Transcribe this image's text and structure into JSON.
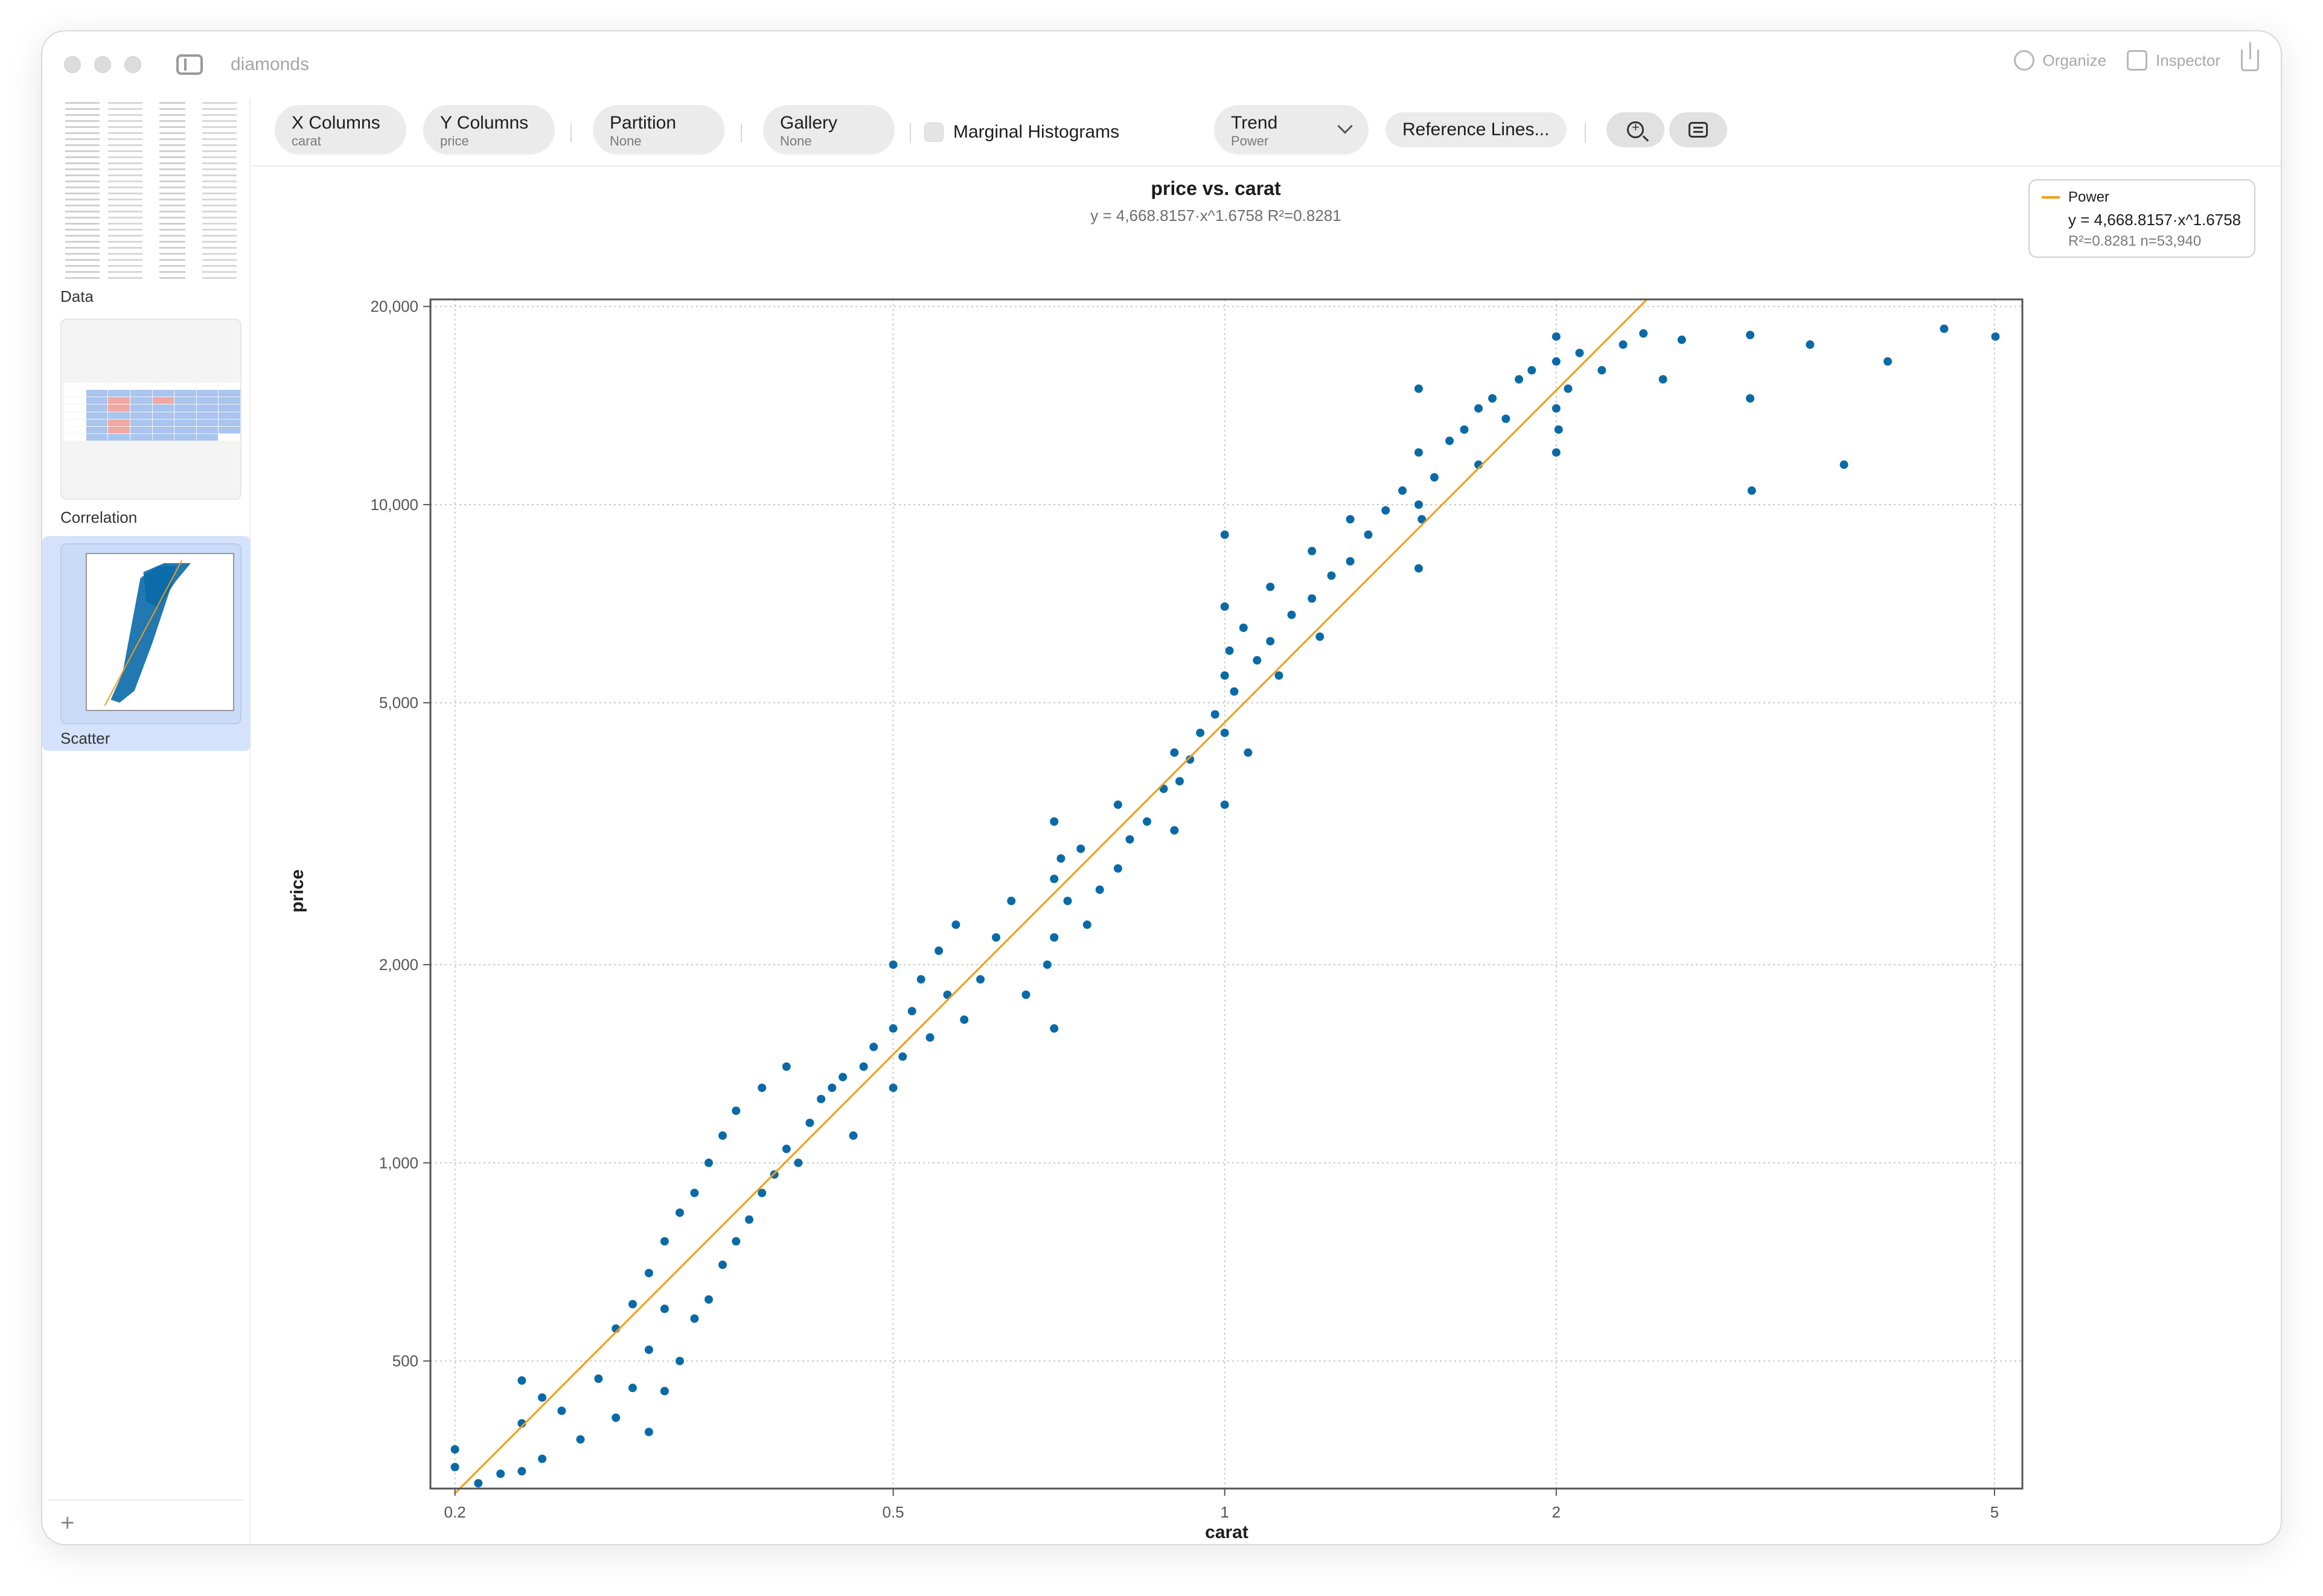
{
  "window": {
    "title": "diamonds"
  },
  "titlebar": {
    "organize_label": "Organize",
    "inspector_label": "Inspector"
  },
  "sidebar": {
    "items": [
      {
        "label": "Data"
      },
      {
        "label": "Correlation"
      },
      {
        "label": "Scatter",
        "selected": true
      }
    ],
    "add_label": "+"
  },
  "toolbar": {
    "x_columns": {
      "title": "X Columns",
      "value": "carat"
    },
    "y_columns": {
      "title": "Y Columns",
      "value": "price"
    },
    "partition": {
      "title": "Partition",
      "value": "None"
    },
    "gallery": {
      "title": "Gallery",
      "value": "None"
    },
    "marginal_histograms": {
      "label": "Marginal Histograms",
      "checked": false
    },
    "trend": {
      "title": "Trend",
      "value": "Power"
    },
    "reference_lines": {
      "label": "Reference Lines..."
    }
  },
  "legend": {
    "name": "Power",
    "equation": "y = 4,668.8157·x^1.6758",
    "stats": "R²=0.8281  n=53,940"
  },
  "colors": {
    "points": "#0a6aa8",
    "trend": "#f39c12",
    "selected_bg": "#d4e3fb"
  },
  "chart_data": {
    "type": "scatter",
    "title": "price vs. carat",
    "subtitle": "y = 4,668.8157·x^1.6758    R²=0.8281",
    "xlabel": "carat",
    "ylabel": "price",
    "x_scale": "log",
    "y_scale": "log",
    "xlim": [
      0.19,
      5.3
    ],
    "ylim": [
      320,
      20500
    ],
    "x_ticks": [
      0.2,
      0.5,
      1,
      2,
      5
    ],
    "x_tick_labels": [
      "0.2",
      "0.5",
      "1",
      "2",
      "5"
    ],
    "y_ticks": [
      500,
      1000,
      2000,
      5000,
      10000,
      20000
    ],
    "y_tick_labels": [
      "500",
      "1,000",
      "2,000",
      "5,000",
      "10,000",
      "20,000"
    ],
    "grid": true,
    "trend": {
      "type": "power",
      "a": 4668.8157,
      "b": 1.6758,
      "r2": 0.8281,
      "n": 53940
    },
    "series": [
      {
        "name": "price",
        "points": [
          [
            0.2,
            345
          ],
          [
            0.2,
            367
          ],
          [
            0.21,
            326
          ],
          [
            0.22,
            337
          ],
          [
            0.23,
            340
          ],
          [
            0.23,
            402
          ],
          [
            0.23,
            467
          ],
          [
            0.24,
            355
          ],
          [
            0.24,
            440
          ],
          [
            0.25,
            420
          ],
          [
            0.26,
            380
          ],
          [
            0.27,
            470
          ],
          [
            0.28,
            410
          ],
          [
            0.28,
            560
          ],
          [
            0.29,
            455
          ],
          [
            0.29,
            610
          ],
          [
            0.3,
            390
          ],
          [
            0.3,
            520
          ],
          [
            0.3,
            680
          ],
          [
            0.31,
            450
          ],
          [
            0.31,
            600
          ],
          [
            0.31,
            760
          ],
          [
            0.32,
            500
          ],
          [
            0.32,
            840
          ],
          [
            0.33,
            580
          ],
          [
            0.33,
            900
          ],
          [
            0.34,
            620
          ],
          [
            0.34,
            1000
          ],
          [
            0.35,
            700
          ],
          [
            0.35,
            1100
          ],
          [
            0.36,
            760
          ],
          [
            0.36,
            1200
          ],
          [
            0.37,
            820
          ],
          [
            0.38,
            900
          ],
          [
            0.38,
            1300
          ],
          [
            0.39,
            960
          ],
          [
            0.4,
            1050
          ],
          [
            0.4,
            1400
          ],
          [
            0.41,
            1000
          ],
          [
            0.42,
            1150
          ],
          [
            0.43,
            1250
          ],
          [
            0.44,
            1300
          ],
          [
            0.45,
            1350
          ],
          [
            0.46,
            1100
          ],
          [
            0.47,
            1400
          ],
          [
            0.48,
            1500
          ],
          [
            0.5,
            1300
          ],
          [
            0.5,
            1600
          ],
          [
            0.5,
            2000
          ],
          [
            0.51,
            1450
          ],
          [
            0.52,
            1700
          ],
          [
            0.53,
            1900
          ],
          [
            0.54,
            1550
          ],
          [
            0.55,
            2100
          ],
          [
            0.56,
            1800
          ],
          [
            0.57,
            2300
          ],
          [
            0.58,
            1650
          ],
          [
            0.6,
            1900
          ],
          [
            0.62,
            2200
          ],
          [
            0.64,
            2500
          ],
          [
            0.66,
            1800
          ],
          [
            0.69,
            2000
          ],
          [
            0.7,
            1600
          ],
          [
            0.7,
            2200
          ],
          [
            0.7,
            2700
          ],
          [
            0.7,
            3300
          ],
          [
            0.71,
            2900
          ],
          [
            0.72,
            2500
          ],
          [
            0.74,
            3000
          ],
          [
            0.75,
            2300
          ],
          [
            0.77,
            2600
          ],
          [
            0.8,
            2800
          ],
          [
            0.8,
            3500
          ],
          [
            0.82,
            3100
          ],
          [
            0.85,
            3300
          ],
          [
            0.88,
            3700
          ],
          [
            0.9,
            3200
          ],
          [
            0.9,
            4200
          ],
          [
            0.91,
            3800
          ],
          [
            0.93,
            4100
          ],
          [
            0.95,
            4500
          ],
          [
            0.98,
            4800
          ],
          [
            1.0,
            3500
          ],
          [
            1.0,
            4500
          ],
          [
            1.0,
            5500
          ],
          [
            1.0,
            7000
          ],
          [
            1.0,
            9000
          ],
          [
            1.01,
            6000
          ],
          [
            1.02,
            5200
          ],
          [
            1.04,
            6500
          ],
          [
            1.05,
            4200
          ],
          [
            1.07,
            5800
          ],
          [
            1.1,
            6200
          ],
          [
            1.1,
            7500
          ],
          [
            1.12,
            5500
          ],
          [
            1.15,
            6800
          ],
          [
            1.2,
            7200
          ],
          [
            1.2,
            8500
          ],
          [
            1.22,
            6300
          ],
          [
            1.25,
            7800
          ],
          [
            1.3,
            8200
          ],
          [
            1.3,
            9500
          ],
          [
            1.35,
            9000
          ],
          [
            1.4,
            9800
          ],
          [
            1.45,
            10500
          ],
          [
            1.5,
            8000
          ],
          [
            1.5,
            10000
          ],
          [
            1.5,
            12000
          ],
          [
            1.5,
            15000
          ],
          [
            1.51,
            9500
          ],
          [
            1.55,
            11000
          ],
          [
            1.6,
            12500
          ],
          [
            1.65,
            13000
          ],
          [
            1.7,
            11500
          ],
          [
            1.7,
            14000
          ],
          [
            1.75,
            14500
          ],
          [
            1.8,
            13500
          ],
          [
            1.85,
            15500
          ],
          [
            1.9,
            16000
          ],
          [
            2.0,
            12000
          ],
          [
            2.0,
            14000
          ],
          [
            2.0,
            16500
          ],
          [
            2.0,
            18000
          ],
          [
            2.01,
            13000
          ],
          [
            2.05,
            15000
          ],
          [
            2.1,
            17000
          ],
          [
            2.2,
            16000
          ],
          [
            2.3,
            17500
          ],
          [
            2.4,
            18200
          ],
          [
            2.5,
            15500
          ],
          [
            2.6,
            17800
          ],
          [
            3.0,
            18100
          ],
          [
            3.0,
            14500
          ],
          [
            3.01,
            10500
          ],
          [
            3.4,
            17500
          ],
          [
            3.65,
            11500
          ],
          [
            4.0,
            16500
          ],
          [
            4.5,
            18500
          ],
          [
            5.01,
            18000
          ]
        ]
      }
    ]
  }
}
